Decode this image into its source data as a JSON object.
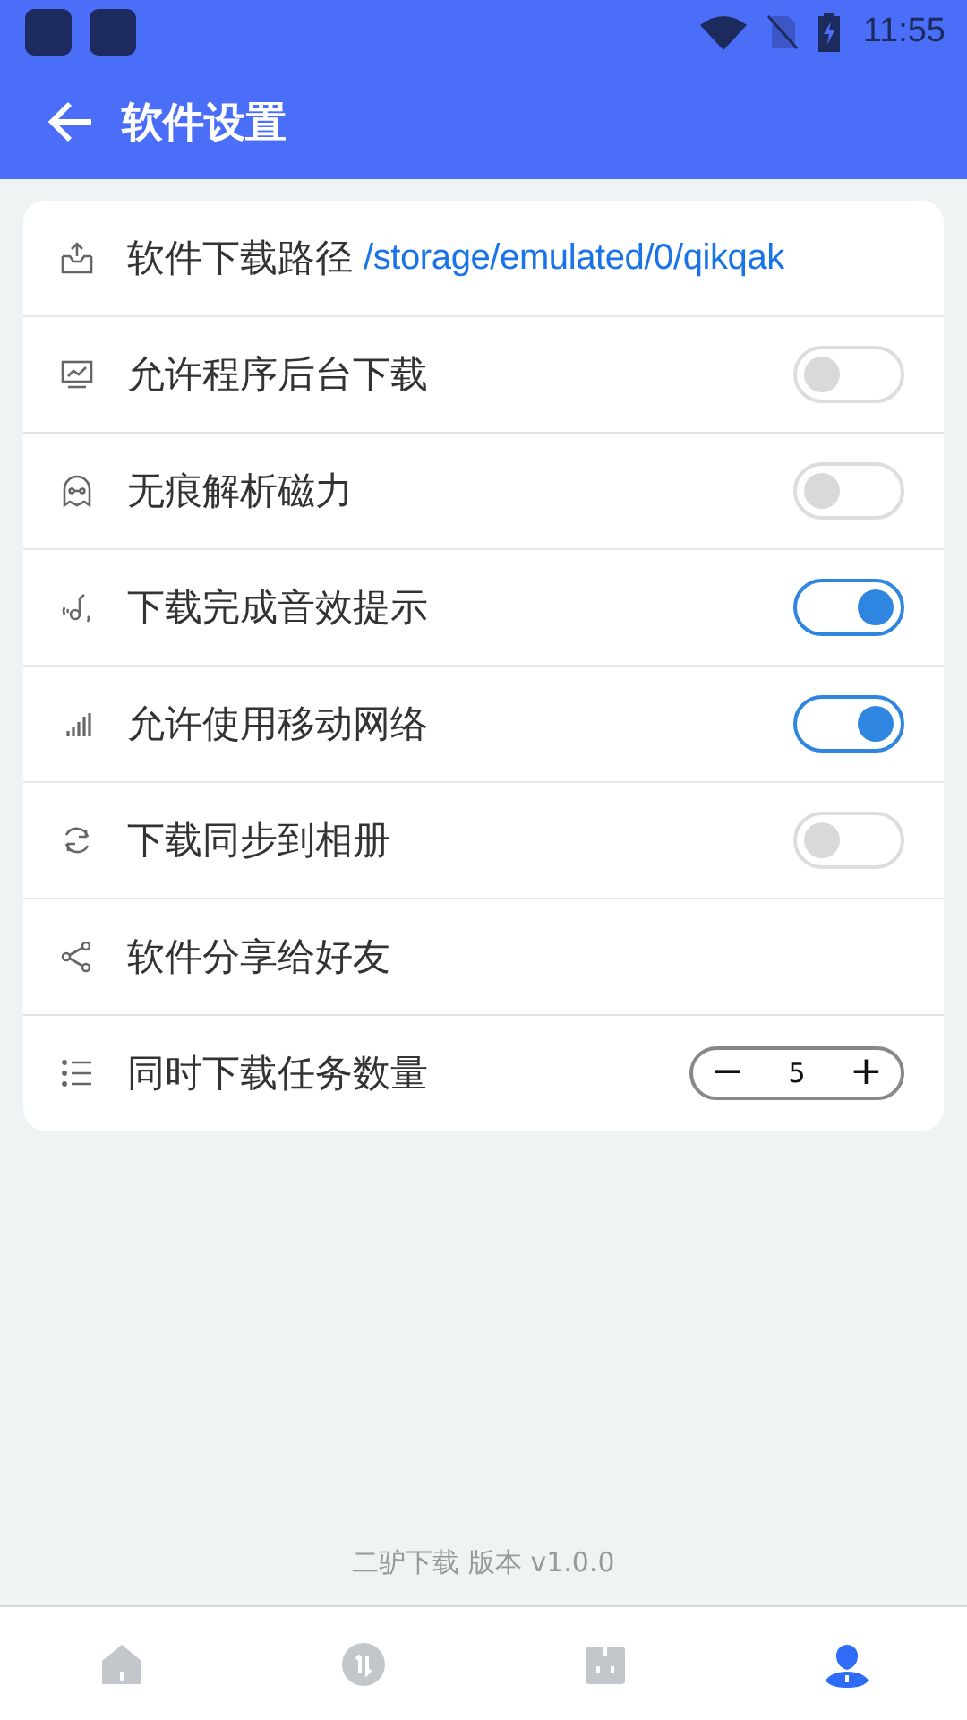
{
  "status_bar": {
    "time": "11:55"
  },
  "header": {
    "title": "软件设置"
  },
  "settings": [
    {
      "kind": "path",
      "label": "软件下载路径",
      "value": "/storage/emulated/0/qikqak"
    },
    {
      "kind": "toggle",
      "label": "允许程序后台下载",
      "on": false
    },
    {
      "kind": "toggle",
      "label": "无痕解析磁力",
      "on": false
    },
    {
      "kind": "toggle",
      "label": "下载完成音效提示",
      "on": true
    },
    {
      "kind": "toggle",
      "label": "允许使用移动网络",
      "on": true
    },
    {
      "kind": "toggle",
      "label": "下载同步到相册",
      "on": false
    },
    {
      "kind": "plain",
      "label": "软件分享给好友"
    },
    {
      "kind": "stepper",
      "label": "同时下载任务数量",
      "value": "5",
      "minus": "−",
      "plus": "+"
    }
  ],
  "footer": {
    "version": "二驴下载 版本 v1.0.0"
  },
  "bottom_nav": [
    {
      "selected": false
    },
    {
      "selected": false
    },
    {
      "selected": false
    },
    {
      "selected": true
    }
  ]
}
